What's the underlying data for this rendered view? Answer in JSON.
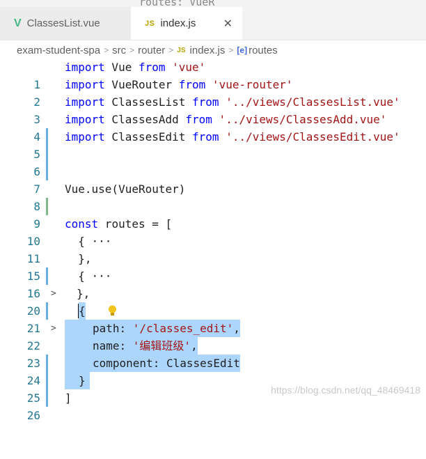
{
  "tabs": [
    {
      "label": "ClassesList.vue",
      "icon": "vue-icon",
      "active": false
    },
    {
      "label": "index.js",
      "icon": "js-icon",
      "active": true
    }
  ],
  "top_sliver_text": "routes: VueR",
  "breadcrumb": {
    "items": [
      "exam-student-spa",
      "src",
      "router",
      "index.js",
      "routes"
    ],
    "js_badge": "JS",
    "symbol_badge": "[e]"
  },
  "lines": [
    {
      "num": "1"
    },
    {
      "num": "2"
    },
    {
      "num": "3"
    },
    {
      "num": "4"
    },
    {
      "num": "5"
    },
    {
      "num": "6"
    },
    {
      "num": "7"
    },
    {
      "num": "8"
    },
    {
      "num": "9"
    },
    {
      "num": "10"
    },
    {
      "num": "11"
    },
    {
      "num": "15"
    },
    {
      "num": "16"
    },
    {
      "num": "20"
    },
    {
      "num": "21"
    },
    {
      "num": "22"
    },
    {
      "num": "23"
    },
    {
      "num": "24"
    },
    {
      "num": "25"
    },
    {
      "num": "26"
    }
  ],
  "code": {
    "l1": {
      "kw1": "import",
      "id": " Vue ",
      "kw2": "from",
      "str": " 'vue'"
    },
    "l2": {
      "kw1": "import",
      "id": " VueRouter ",
      "kw2": "from",
      "str": " 'vue-router'"
    },
    "l3": {
      "kw1": "import",
      "id": " ClassesList ",
      "kw2": "from",
      "str": " '../views/ClassesList.vue'"
    },
    "l4": {
      "kw1": "import",
      "id": " ClassesAdd ",
      "kw2": "from",
      "str": " '../views/ClassesAdd.vue'"
    },
    "l5": {
      "kw1": "import",
      "id": " ClassesEdit ",
      "kw2": "from",
      "str": " '../views/ClassesEdit.vue'"
    },
    "l8": "Vue.use(VueRouter)",
    "l10": {
      "kw": "const",
      "rest": " routes = ["
    },
    "l11": "  { ···",
    "l15": "  },",
    "l16": "  { ···",
    "l20": "},",
    "l21": "{",
    "l22": {
      "key": "path: ",
      "str": "'/classes_edit'",
      "tail": ","
    },
    "l23": {
      "key": "name: ",
      "str": "'编辑班级'",
      "tail": ","
    },
    "l24": "component: ClassesEdit",
    "l25": "}",
    "l26": "]"
  },
  "watermark": "https://blog.csdn.net/qq_48469418",
  "colors": {
    "keyword": "#0000ff",
    "string": "#a31515",
    "line_number": "#237893",
    "selection": "#add6ff"
  }
}
